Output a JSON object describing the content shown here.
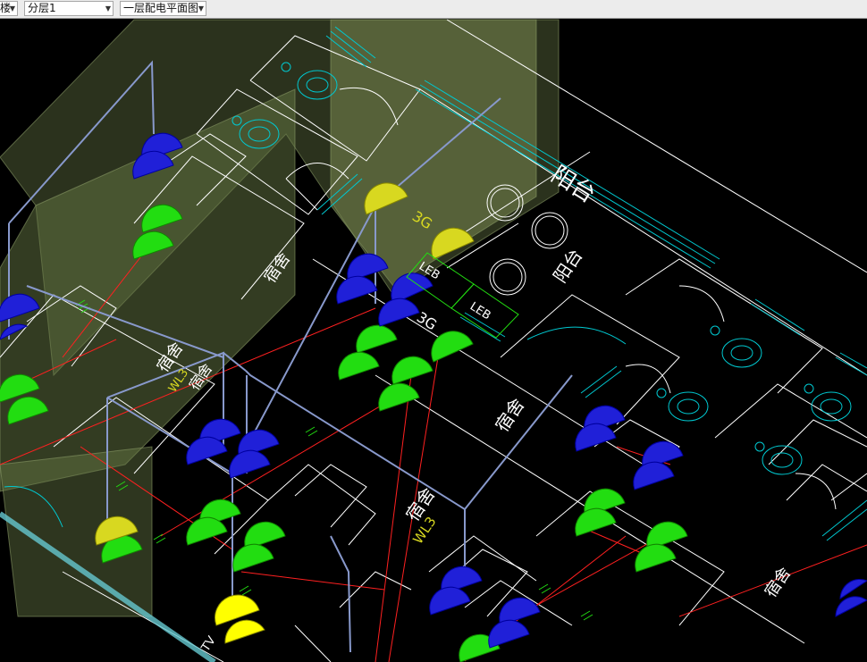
{
  "toolbar": {
    "floor_combo": {
      "value": "楼"
    },
    "layer_combo": {
      "value": "分层1"
    },
    "drawing_combo": {
      "value": "一层配电平面图"
    }
  },
  "drawing": {
    "labels": {
      "balcony_large": "阳台",
      "balcony_small": "阳台",
      "dorm_1": "宿舍",
      "dorm_2": "宿舍",
      "dorm_3": "宿舍",
      "dorm_4": "宿舍",
      "dorm_5": "宿舍",
      "dorm_6": "宿舍",
      "code_3g_1": "3G",
      "code_3g_2": "3G",
      "code_leb_1": "LEB",
      "code_leb_2": "LEB",
      "code_wl3": "WL3",
      "code_wl3_left": "WL3",
      "code_tv": "TV"
    },
    "colors": {
      "background": "#000000",
      "wall_line": "#ffffff",
      "window_line": "#00c8d0",
      "cable_red": "#ff2020",
      "device_green": "#22dd11",
      "device_blue": "#2020d8",
      "device_yellow": "#d8d820",
      "box_outline": "#8899cc",
      "leb_box": "#22dd11",
      "wall_3d": "#667744"
    }
  }
}
